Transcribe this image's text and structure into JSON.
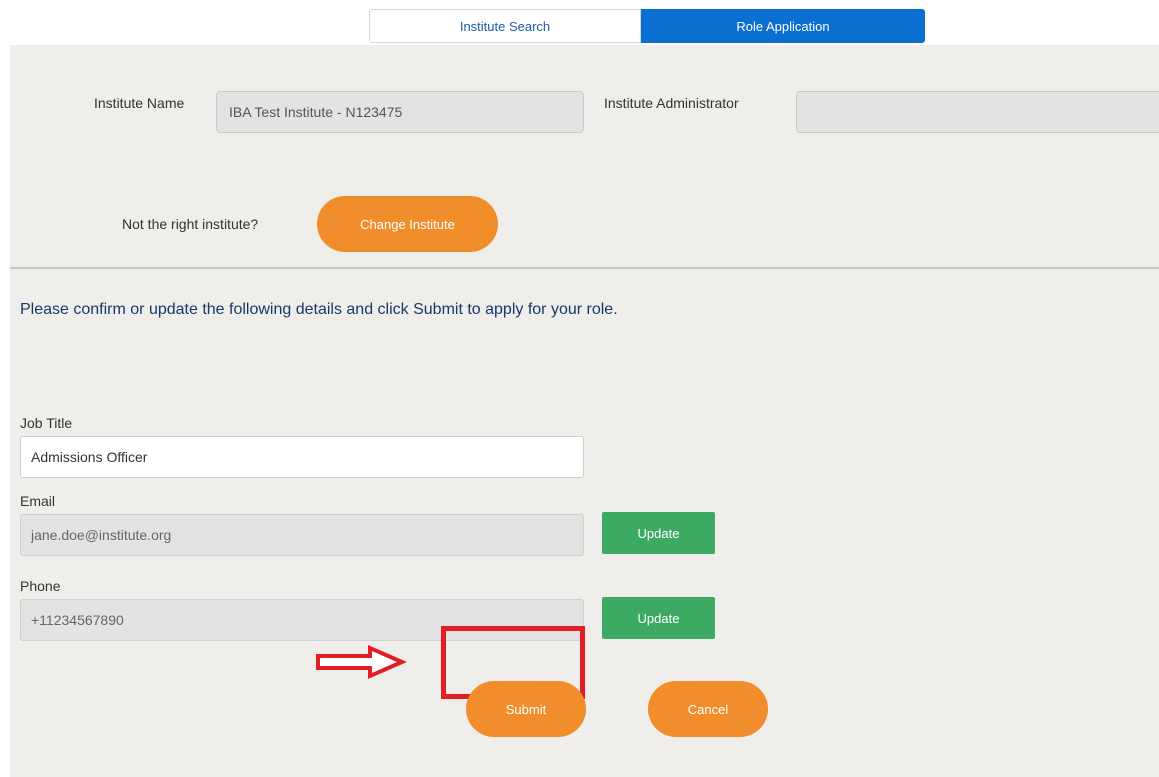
{
  "tabs": [
    {
      "label": "Institute Search",
      "active": false
    },
    {
      "label": "Role Application",
      "active": true
    }
  ],
  "institute": {
    "name_label": "Institute Name",
    "name_value": "IBA Test Institute - N123475",
    "admin_label": "Institute Administrator",
    "admin_value": "",
    "not_right_text": "Not the right institute?",
    "change_label": "Change Institute"
  },
  "instructions": "Please confirm or update the following details and click Submit to apply for your role.",
  "form": {
    "job_title_label": "Job Title",
    "job_title_value": "Admissions Officer",
    "email_label": "Email",
    "email_value": "jane.doe@institute.org",
    "email_update_label": "Update",
    "phone_label": "Phone",
    "phone_value": "+11234567890",
    "phone_update_label": "Update"
  },
  "actions": {
    "submit_label": "Submit",
    "cancel_label": "Cancel"
  },
  "colors": {
    "tab_active": "#0b6fd1",
    "orange": "#f18d2a",
    "green": "#3daa63",
    "highlight_red": "#e21d24",
    "panel_bg": "#f0eeeb",
    "instructions_text": "#17386b"
  },
  "annotation": {
    "arrow_icon": "right-arrow-icon"
  }
}
